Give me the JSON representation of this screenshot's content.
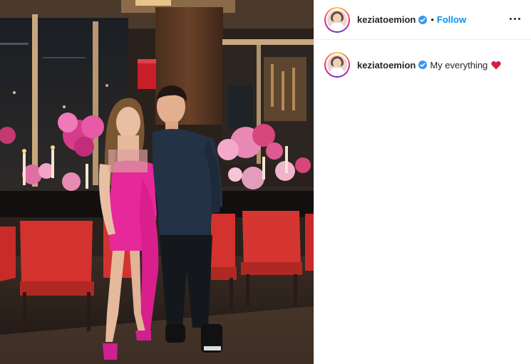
{
  "post": {
    "author": {
      "username": "keziatoemion",
      "verified": true,
      "avatar_icon": "profile-photo"
    },
    "header": {
      "separator": "•",
      "follow_label": "Follow",
      "more_icon": "more-horizontal-icon"
    },
    "caption": {
      "username": "keziatoemion",
      "text": "My everything",
      "emoji_icon": "red-heart-icon"
    }
  },
  "colors": {
    "follow_blue": "#0095f6",
    "verified_blue": "#3897f0",
    "heart_red": "#e0245e",
    "divider": "#efefef",
    "text_primary": "#262626"
  }
}
